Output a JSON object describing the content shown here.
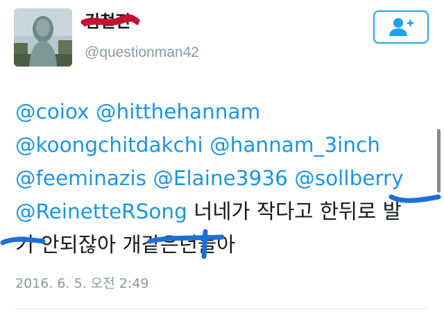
{
  "profile": {
    "display_name": "김철진",
    "username": "@questionman42",
    "avatar_icon": "avatar-statue-photo",
    "follow_icon": "add-user-icon"
  },
  "tweet": {
    "line1": [
      "@coiox",
      "@hitthehannam"
    ],
    "line2": [
      "@koongchitdakchi",
      "@hannam_3inch"
    ],
    "line3": [
      "@feeminazis",
      "@Elaine3936",
      "@sollberry"
    ],
    "line4_mention": "@ReinetteRSong",
    "line4_text": "너네가 작다고 한뒤로 발",
    "line5_text": "기 안되잖아 개같은년들아"
  },
  "timestamp": "2016. 6. 5. 오전 2:49",
  "colors": {
    "mention": "#1b95e0",
    "text": "#14171a",
    "meta": "#8899a6",
    "follow_border": "#1da1f2",
    "redaction_red": "#c41230",
    "redaction_blue": "#1d6fd8"
  }
}
